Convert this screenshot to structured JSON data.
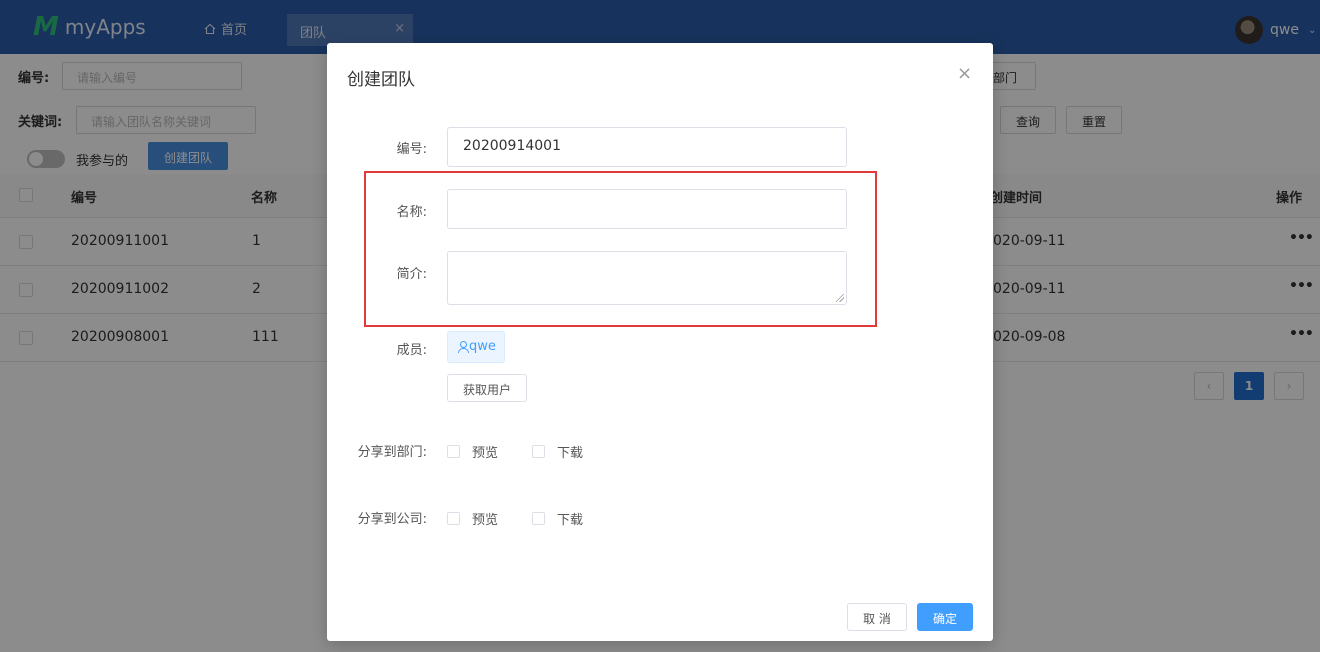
{
  "header": {
    "logo_mark": "M",
    "logo_text": "myApps",
    "home_label": "首页",
    "active_tab": "团队",
    "user_name": "qwe"
  },
  "page": {
    "filter_code_label": "编号:",
    "filter_code_placeholder": "请输入编号",
    "filter_keyword_label": "关键词:",
    "filter_keyword_placeholder": "请输入团队名称关键词",
    "dept_button_partial": "部门",
    "query_button": "查询",
    "reset_button": "重置",
    "toggle_label": "我参与的",
    "create_button": "创建团队",
    "table": {
      "headers": {
        "code": "编号",
        "name": "名称",
        "created": "创建时间",
        "actions": "操作"
      },
      "rows": [
        {
          "code": "20200911001",
          "name": "1",
          "created": "020-09-11"
        },
        {
          "code": "20200911002",
          "name": "2",
          "created": "020-09-11"
        },
        {
          "code": "20200908001",
          "name": "111",
          "created": "020-09-08"
        }
      ],
      "more": "•••"
    },
    "pagination": {
      "prev": "‹",
      "current": "1",
      "next": "›"
    }
  },
  "modal": {
    "title": "创建团队",
    "close": "×",
    "code_label": "编号:",
    "code_value": "20200914001",
    "name_label": "名称:",
    "name_value": "",
    "intro_label": "简介:",
    "members_label": "成员:",
    "member_tag": "qwe",
    "get_users_button": "获取用户",
    "share_dept_label": "分享到部门:",
    "share_company_label": "分享到公司:",
    "preview_label": "预览",
    "download_label": "下载",
    "cancel_button": "取 消",
    "confirm_button": "确定"
  },
  "colors": {
    "header_bg": "#2a5ba8",
    "accent": "#409eff",
    "highlight_border": "#e03b3b"
  }
}
